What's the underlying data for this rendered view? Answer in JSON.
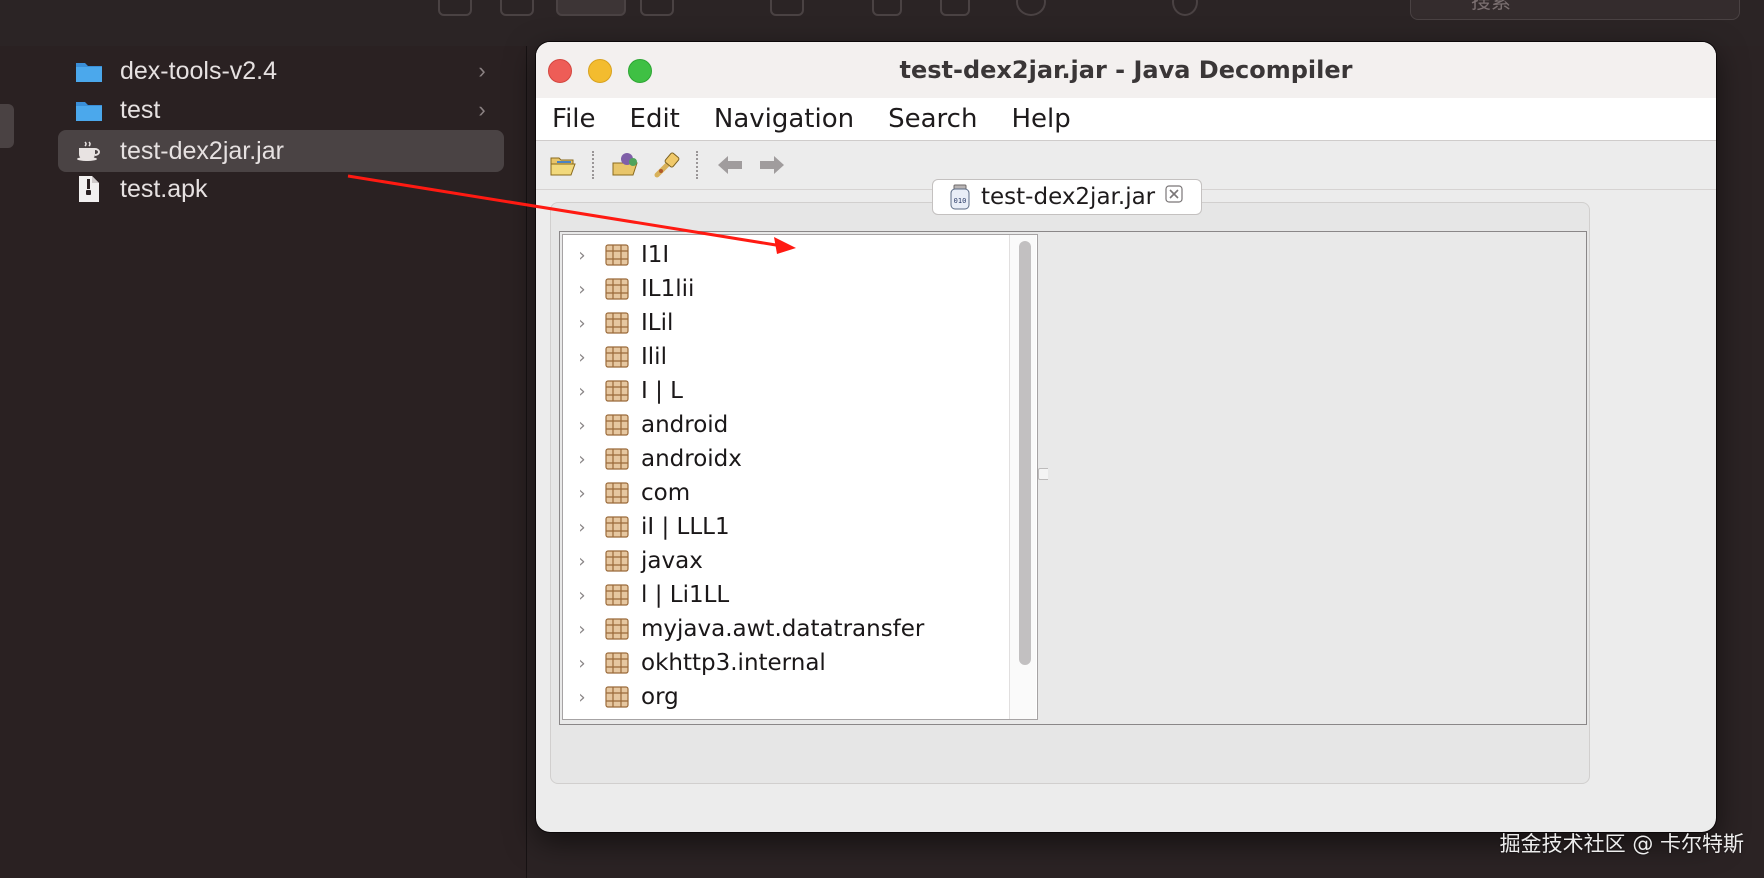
{
  "finder": {
    "search_placeholder": "搜索",
    "items": [
      {
        "label": "dex-tools-v2.4",
        "icon": "folder-icon",
        "has_children": true,
        "selected": false
      },
      {
        "label": "test",
        "icon": "folder-icon",
        "has_children": true,
        "selected": false
      },
      {
        "label": "test-dex2jar.jar",
        "icon": "java-jar-icon",
        "has_children": false,
        "selected": true
      },
      {
        "label": "test.apk",
        "icon": "document-icon",
        "has_children": false,
        "selected": false
      }
    ]
  },
  "window": {
    "title": "test-dex2jar.jar - Java Decompiler",
    "menu": [
      "File",
      "Edit",
      "Navigation",
      "Search",
      "Help"
    ],
    "toolbar_icons": [
      "open-file-icon",
      "open-type-icon",
      "search-icon",
      "back-icon",
      "forward-icon"
    ],
    "tab": {
      "label": "test-dex2jar.jar",
      "icon": "jar-binary-icon",
      "close_icon": "close-tab-icon"
    },
    "tree": [
      "I1I",
      "IL1lii",
      "ILil",
      "Ilil",
      "I | L",
      "android",
      "androidx",
      "com",
      "iI | LLL1",
      "javax",
      "l | Li1LL",
      "myjava.awt.datatransfer",
      "okhttp3.internal",
      "org"
    ]
  },
  "annotation": {
    "arrow_color": "#ff1a12"
  },
  "watermark": "掘金技术社区 @ 卡尔特斯",
  "colors": {
    "finder_bg": "#2a2122",
    "finder_selected": "#4a4344",
    "folder_blue": "#4ba8ec",
    "close": "#ee5d57",
    "minimize": "#f3bc2f",
    "maximize": "#3fc044"
  }
}
